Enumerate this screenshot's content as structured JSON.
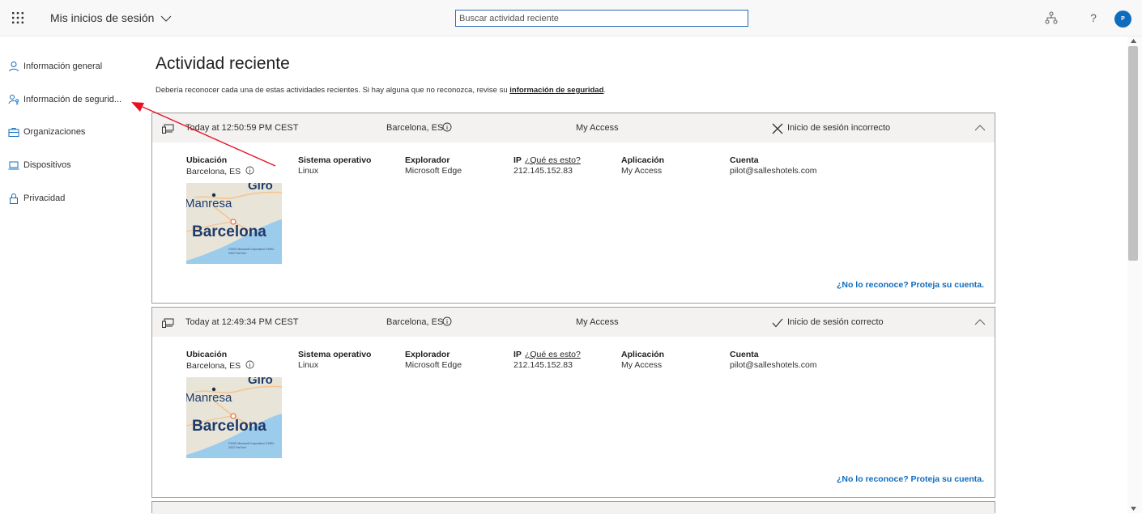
{
  "header": {
    "app_title": "Mis inicios de sesión",
    "search_placeholder": "Buscar actividad reciente",
    "avatar_initial": "P",
    "help": "?"
  },
  "sidebar": {
    "items": [
      {
        "label": "Información general",
        "icon": "person-icon"
      },
      {
        "label": "Información de segurid...",
        "icon": "key-person-icon"
      },
      {
        "label": "Organizaciones",
        "icon": "briefcase-icon"
      },
      {
        "label": "Dispositivos",
        "icon": "laptop-icon"
      },
      {
        "label": "Privacidad",
        "icon": "lock-icon"
      }
    ]
  },
  "main": {
    "title": "Actividad reciente",
    "subtitle_text": "Debería reconocer cada una de estas actividades recientes. Si hay alguna que no reconozca, revise su ",
    "subtitle_link": "información de seguridad",
    "subtitle_end": ".",
    "activities": [
      {
        "time": "Today at 12:50:59 PM CEST",
        "location": "Barcelona, ES",
        "app": "My Access",
        "status": "Inicio de sesión incorrecto",
        "status_icon": "x-icon",
        "labels": {
          "location": "Ubicación",
          "os": "Sistema operativo",
          "browser": "Explorador",
          "ip": "IP",
          "ip_help": "¿Qué es esto?",
          "app": "Aplicación",
          "account": "Cuenta"
        },
        "values": {
          "location": "Barcelona, ES",
          "os": "Linux",
          "browser": "Microsoft Edge",
          "ip": "212.145.152.83",
          "app": "My Access",
          "account": "pilot@salleshotels.com"
        },
        "map_labels": {
          "city1": "Giro",
          "city2": "Manresa",
          "city3": "Barcelona",
          "copyright": "©2022 Microsoft Corporation ©1992-2022 TomTom"
        },
        "reco_link": "¿No lo reconoce? Proteja su cuenta."
      },
      {
        "time": "Today at 12:49:34 PM CEST",
        "location": "Barcelona, ES",
        "app": "My Access",
        "status": "Inicio de sesión correcto",
        "status_icon": "check-icon",
        "labels": {
          "location": "Ubicación",
          "os": "Sistema operativo",
          "browser": "Explorador",
          "ip": "IP",
          "ip_help": "¿Qué es esto?",
          "app": "Aplicación",
          "account": "Cuenta"
        },
        "values": {
          "location": "Barcelona, ES",
          "os": "Linux",
          "browser": "Microsoft Edge",
          "ip": "212.145.152.83",
          "app": "My Access",
          "account": "pilot@salleshotels.com"
        },
        "map_labels": {
          "city1": "Giro",
          "city2": "Manresa",
          "city3": "Barcelona",
          "copyright": "©2022 Microsoft Corporation ©1992-2022 TomTom"
        },
        "reco_link": "¿No lo reconoce? Proteja su cuenta."
      }
    ]
  },
  "colors": {
    "accent": "#0f6cbd",
    "annotation_arrow": "#e81123",
    "header_bg": "#f3f2f1"
  }
}
